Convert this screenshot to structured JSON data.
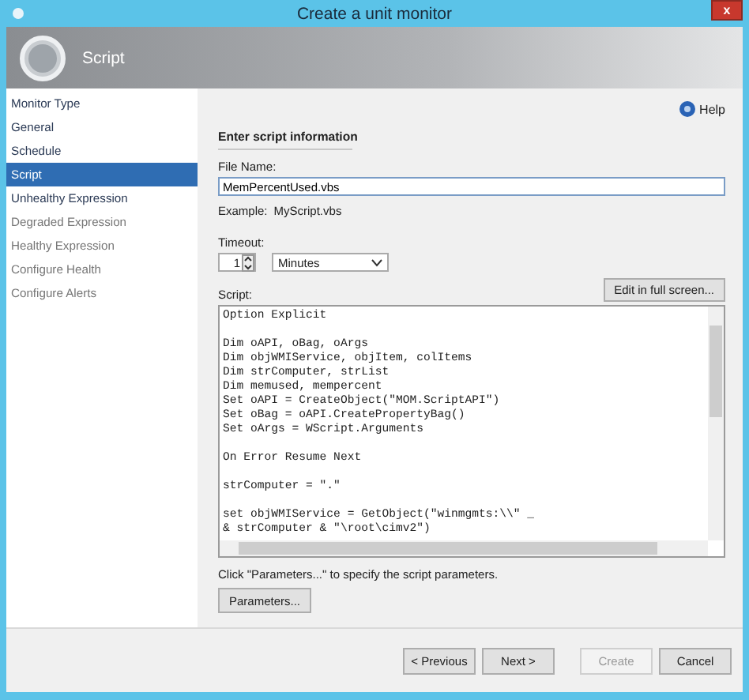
{
  "window": {
    "title": "Create a unit monitor",
    "close": "x"
  },
  "header": {
    "title": "Script"
  },
  "sidebar": {
    "items": [
      {
        "label": "Monitor Type",
        "selected": false,
        "disabled": false
      },
      {
        "label": "General",
        "selected": false,
        "disabled": false
      },
      {
        "label": "Schedule",
        "selected": false,
        "disabled": false
      },
      {
        "label": "Script",
        "selected": true,
        "disabled": false
      },
      {
        "label": "Unhealthy Expression",
        "selected": false,
        "disabled": false
      },
      {
        "label": "Degraded Expression",
        "selected": false,
        "disabled": true
      },
      {
        "label": "Healthy Expression",
        "selected": false,
        "disabled": true
      },
      {
        "label": "Configure Health",
        "selected": false,
        "disabled": true
      },
      {
        "label": "Configure Alerts",
        "selected": false,
        "disabled": true
      }
    ]
  },
  "help": "Help",
  "section_title": "Enter script information",
  "file_name": {
    "label": "File Name:",
    "value": "MemPercentUsed.vbs",
    "example_label": "Example:",
    "example": "MyScript.vbs"
  },
  "timeout": {
    "label": "Timeout:",
    "value": "1",
    "unit": "Minutes"
  },
  "script": {
    "label": "Script:",
    "edit_button": "Edit in full screen...",
    "blocks": [
      [
        "Option Explicit"
      ],
      [
        "Dim oAPI, oBag, oArgs",
        "Dim objWMIService, objItem, colItems",
        "Dim strComputer, strList",
        "Dim memused, mempercent",
        "Set oAPI = CreateObject(\"MOM.ScriptAPI\")",
        "Set oBag = oAPI.CreatePropertyBag()",
        "Set oArgs = WScript.Arguments"
      ],
      [
        "On Error Resume Next"
      ],
      [
        "strComputer = \".\""
      ],
      [
        "set objWMIService = GetObject(\"winmgmts:\\\\\" _",
        "& strComputer & \"\\root\\cimv2\")"
      ]
    ]
  },
  "parameters_hint": "Click \"Parameters...\" to specify the script parameters.",
  "parameters_button": "Parameters...",
  "buttons": [
    {
      "label": "< Previous",
      "disabled": false
    },
    {
      "label": "Next >",
      "disabled": false
    },
    {
      "label": "Create",
      "disabled": true
    },
    {
      "label": "Cancel",
      "disabled": false
    }
  ]
}
